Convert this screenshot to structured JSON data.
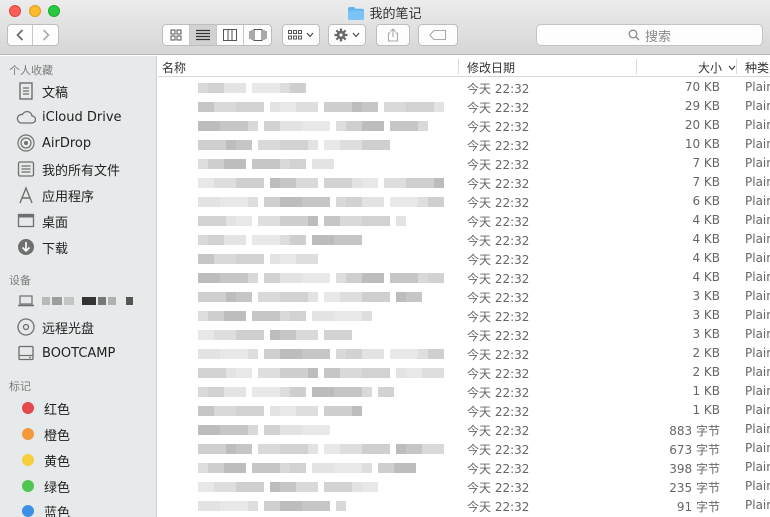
{
  "window": {
    "title": "我的笔记",
    "search_placeholder": "搜索"
  },
  "sidebar": {
    "favorites_title": "个人收藏",
    "favorites": [
      {
        "label": "文稿",
        "icon": "document-icon"
      },
      {
        "label": "iCloud Drive",
        "icon": "cloud-icon"
      },
      {
        "label": "AirDrop",
        "icon": "airdrop-icon"
      },
      {
        "label": "我的所有文件",
        "icon": "all-files-icon"
      },
      {
        "label": "应用程序",
        "icon": "applications-icon"
      },
      {
        "label": "桌面",
        "icon": "desktop-icon"
      },
      {
        "label": "下载",
        "icon": "download-icon"
      }
    ],
    "devices_title": "设备",
    "devices": [
      {
        "label": "远程光盘",
        "icon": "disc-icon"
      },
      {
        "label": "BOOTCAMP",
        "icon": "drive-icon"
      }
    ],
    "tags_title": "标记",
    "tags": [
      {
        "label": "红色",
        "color": "#e5484d"
      },
      {
        "label": "橙色",
        "color": "#f29a3a"
      },
      {
        "label": "黄色",
        "color": "#f5cf3c"
      },
      {
        "label": "绿色",
        "color": "#4fc64f"
      },
      {
        "label": "蓝色",
        "color": "#3d8fe8"
      }
    ]
  },
  "columns": {
    "name": "名称",
    "date": "修改日期",
    "size": "大小",
    "kind": "种类"
  },
  "files": [
    {
      "date": "今天 22:32",
      "size": "70 KB",
      "kind": "Plain"
    },
    {
      "date": "今天 22:32",
      "size": "29 KB",
      "kind": "Plain"
    },
    {
      "date": "今天 22:32",
      "size": "20 KB",
      "kind": "Plain"
    },
    {
      "date": "今天 22:32",
      "size": "10 KB",
      "kind": "Plain"
    },
    {
      "date": "今天 22:32",
      "size": "7 KB",
      "kind": "Plain"
    },
    {
      "date": "今天 22:32",
      "size": "7 KB",
      "kind": "Plain"
    },
    {
      "date": "今天 22:32",
      "size": "6 KB",
      "kind": "Plain"
    },
    {
      "date": "今天 22:32",
      "size": "4 KB",
      "kind": "Plain"
    },
    {
      "date": "今天 22:32",
      "size": "4 KB",
      "kind": "Plain"
    },
    {
      "date": "今天 22:32",
      "size": "4 KB",
      "kind": "Plain"
    },
    {
      "date": "今天 22:32",
      "size": "4 KB",
      "kind": "Plain"
    },
    {
      "date": "今天 22:32",
      "size": "3 KB",
      "kind": "Plain"
    },
    {
      "date": "今天 22:32",
      "size": "3 KB",
      "kind": "Plain"
    },
    {
      "date": "今天 22:32",
      "size": "3 KB",
      "kind": "Plain"
    },
    {
      "date": "今天 22:32",
      "size": "2 KB",
      "kind": "Plain"
    },
    {
      "date": "今天 22:32",
      "size": "2 KB",
      "kind": "Plain"
    },
    {
      "date": "今天 22:32",
      "size": "1 KB",
      "kind": "Plain"
    },
    {
      "date": "今天 22:32",
      "size": "1 KB",
      "kind": "Plain"
    },
    {
      "date": "今天 22:32",
      "size": "883 字节",
      "kind": "Plain"
    },
    {
      "date": "今天 22:32",
      "size": "673 字节",
      "kind": "Plain"
    },
    {
      "date": "今天 22:32",
      "size": "398 字节",
      "kind": "Plain"
    },
    {
      "date": "今天 22:32",
      "size": "235 字节",
      "kind": "Plain"
    },
    {
      "date": "今天 22:32",
      "size": "91 字节",
      "kind": "Plain"
    }
  ]
}
